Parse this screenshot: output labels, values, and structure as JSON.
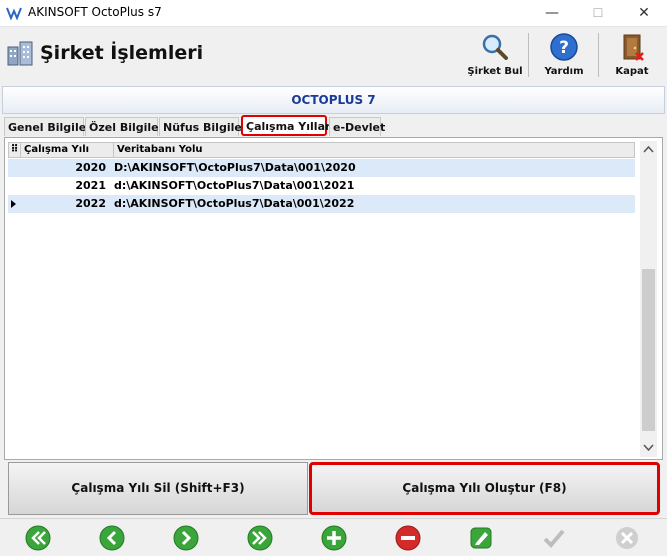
{
  "window": {
    "title": "AKINSOFT OctoPlus s7",
    "minimize": "—",
    "maximize": "☐",
    "close": "✕"
  },
  "header": {
    "title": "Şirket İşlemleri",
    "buttons": [
      {
        "label": "Şirket Bul",
        "icon": "search-icon"
      },
      {
        "label": "Yardım",
        "icon": "help-icon"
      },
      {
        "label": "Kapat",
        "icon": "exit-door-icon"
      }
    ]
  },
  "banner": "OCTOPLUS 7",
  "tabs": [
    "Genel Bilgiler",
    "Özel Bilgiler",
    "Nüfus Bilgileri",
    "Çalışma Yılları",
    "e-Devlet"
  ],
  "active_tab": "Çalışma Yılları",
  "grid": {
    "columns": [
      "Çalışma Yılı",
      "Veritabanı Yolu"
    ],
    "rows": [
      {
        "year": "2020",
        "path": "D:\\AKINSOFT\\OctoPlus7\\Data\\001\\2020"
      },
      {
        "year": "2021",
        "path": "d:\\AKINSOFT\\OctoPlus7\\Data\\001\\2021"
      },
      {
        "year": "2022",
        "path": "d:\\AKINSOFT\\OctoPlus7\\Data\\001\\2022"
      }
    ]
  },
  "actions": {
    "delete": "Çalışma Yılı Sil (Shift+F3)",
    "create": "Çalışma Yılı Oluştur (F8)"
  },
  "nav_icons": [
    "first-record-icon",
    "previous-record-icon",
    "next-record-icon",
    "last-record-icon",
    "add-icon",
    "delete-icon",
    "edit-icon",
    "save-check-icon",
    "cancel-icon"
  ],
  "colors": {
    "accent": "#1a3a9a",
    "highlight": "#e00000",
    "row_selected": "#dbe9f8",
    "nav_green": "#3aa53a",
    "nav_red": "#d42a2a"
  }
}
